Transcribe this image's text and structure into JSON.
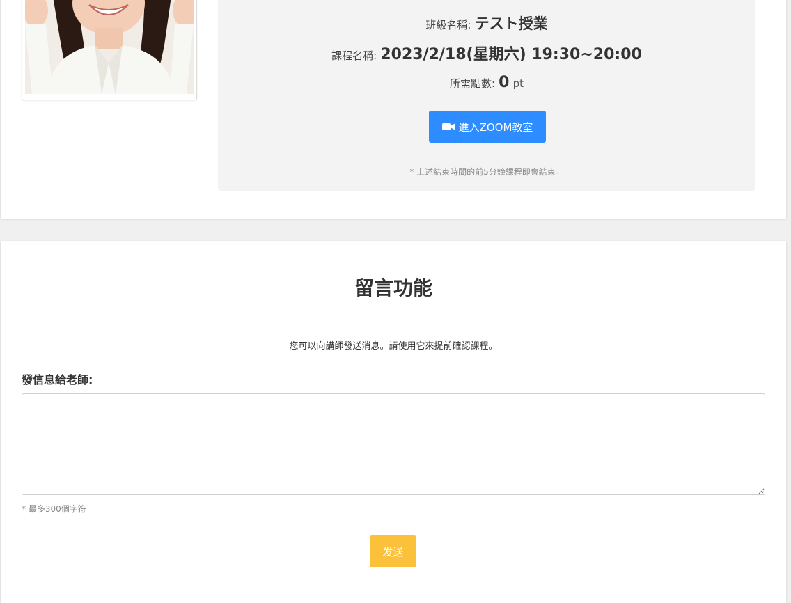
{
  "lesson": {
    "class_label": "班級名稱:",
    "class_value": "テスト授業",
    "course_label": "課程名稱:",
    "course_value": "2023/2/18(星期六) 19:30~20:00",
    "points_label": "所需點數:",
    "points_value": "0",
    "points_unit": "pt",
    "zoom_button_label": "進入ZOOM教室",
    "note": "* 上述結束時間的前5分鐘課程即會結束。"
  },
  "message": {
    "title": "留言功能",
    "description": "您可以向講師發送消息。請使用它來提前確認課程。",
    "field_label": "發信息給老師:",
    "input_value": "",
    "limit_note": "* 最多300個字符",
    "send_label": "发送"
  },
  "colors": {
    "zoom_button": "#2d8cff",
    "send_button": "#fbc13a",
    "panel_bg": "#f3f3f3"
  },
  "icons": {
    "zoom_button_icon": "video-camera-icon"
  }
}
